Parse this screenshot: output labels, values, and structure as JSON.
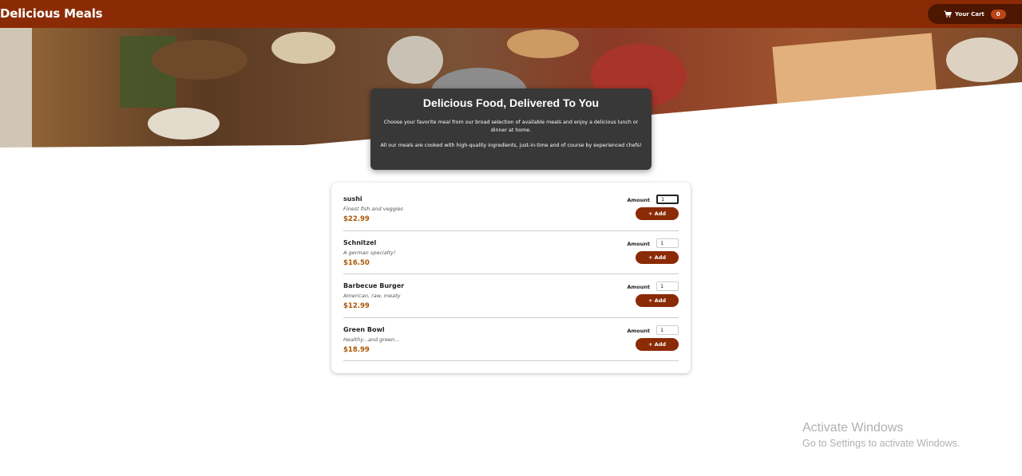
{
  "header": {
    "brand": "Delicious Meals",
    "cart_label": "Your Cart",
    "cart_count": "0",
    "cart_icon": "cart-icon"
  },
  "summary": {
    "title": "Delicious Food, Delivered To You",
    "p1": "Choose your favorite meal from our broad selection of available meals and enjoy a delicious lunch or dinner at home.",
    "p2": "All our meals are cooked with high-quality ingredients, just-in-time and of course by experienced chefs!"
  },
  "meals": [
    {
      "name": "sushi",
      "description": "Finest fish and veggies",
      "price": "$22.99",
      "amount_label": "Amount",
      "amount": "1",
      "add_label": "+ Add"
    },
    {
      "name": "Schnitzel",
      "description": "A german specialty!",
      "price": "$16.50",
      "amount_label": "Amount",
      "amount": "1",
      "add_label": "+ Add"
    },
    {
      "name": "Barbecue Burger",
      "description": "American, raw, meaty",
      "price": "$12.99",
      "amount_label": "Amount",
      "amount": "1",
      "add_label": "+ Add"
    },
    {
      "name": "Green Bowl",
      "description": "Healthy...and green...",
      "price": "$18.99",
      "amount_label": "Amount",
      "amount": "1",
      "add_label": "+ Add"
    }
  ],
  "watermark": {
    "line1": "Activate Windows",
    "line2": "Go to Settings to activate Windows."
  },
  "colors": {
    "header": "#8a2b06",
    "cart_button": "#4d1601",
    "badge": "#b94517",
    "price": "#ad5502",
    "summary_bg": "#383838"
  }
}
